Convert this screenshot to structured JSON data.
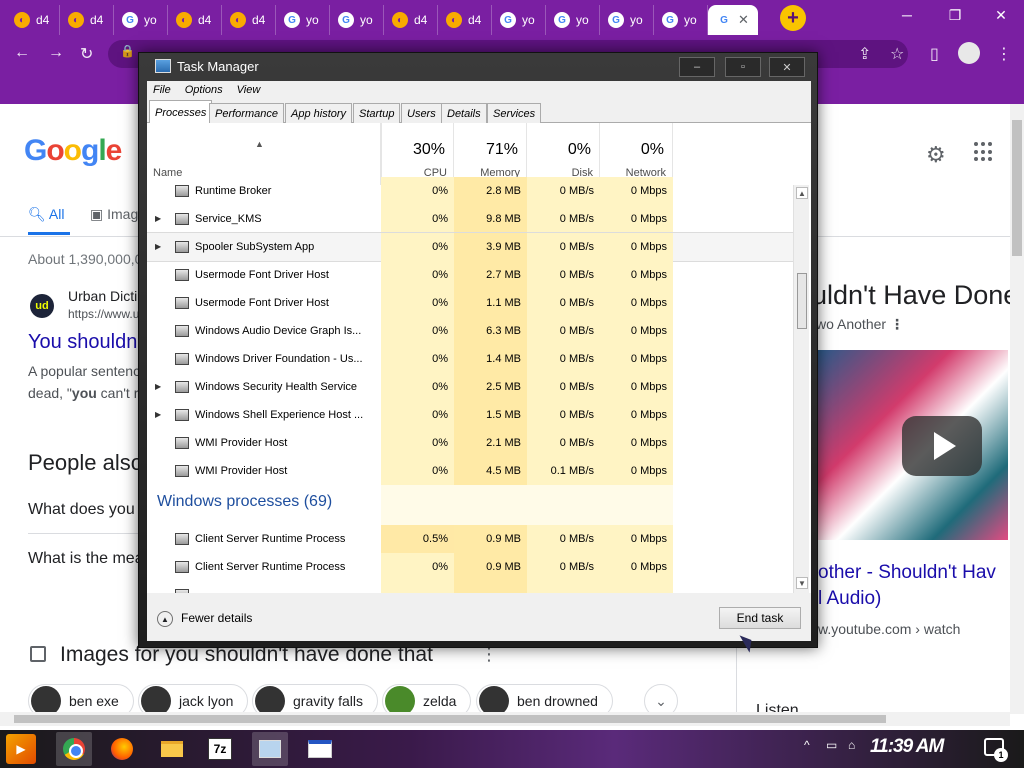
{
  "browser": {
    "tabs": [
      {
        "favicon": "d4-favicon",
        "label": "d4"
      },
      {
        "favicon": "d4-favicon",
        "label": "d4"
      },
      {
        "favicon": "google-favicon",
        "label": "yo"
      },
      {
        "favicon": "d4-favicon",
        "label": "d4"
      },
      {
        "favicon": "d4-favicon",
        "label": "d4"
      },
      {
        "favicon": "google-favicon",
        "label": "yo"
      },
      {
        "favicon": "google-favicon",
        "label": "yo"
      },
      {
        "favicon": "d4-favicon",
        "label": "d4"
      },
      {
        "favicon": "d4-favicon",
        "label": "d4"
      },
      {
        "favicon": "google-favicon",
        "label": "yo"
      },
      {
        "favicon": "google-favicon",
        "label": "yo"
      },
      {
        "favicon": "google-favicon",
        "label": "yo"
      },
      {
        "favicon": "google-favicon",
        "label": "yo"
      }
    ],
    "active_tab_close": "✕",
    "new_tab": "+",
    "theme_color": "#7a1fa2"
  },
  "google": {
    "logo": [
      "G",
      "o",
      "o",
      "g",
      "l",
      "e"
    ],
    "tab_all": "All",
    "tab_images": "Imag",
    "about": "About 1,390,000,0",
    "result": {
      "site_name": "Urban Dicti",
      "site_url": "https://www.u",
      "site_logo": "ud",
      "title": "You shouldn",
      "snippet1": "A popular sentenc",
      "snippet2_pre": "dead, \"",
      "snippet2_bold": "you",
      "snippet2_post": " can't r"
    },
    "people_also_ask": "People also",
    "paa_q1": "What does you",
    "paa_q2": "What is the mea",
    "images_title": "Images for you shouldn't have done that",
    "images_more": "⋮",
    "chips": [
      "ben exe",
      "jack lyon",
      "gravity falls",
      "zelda",
      "ben drowned"
    ],
    "chip_next": "⌄",
    "right_panel": {
      "title": "uldn't Have Done",
      "subtitle": "wo Another",
      "subtitle_menu": "⋮",
      "video_title1": "other - Shouldn't Hav",
      "video_title2": "l Audio)",
      "video_source": "w.youtube.com › watch",
      "listen": "Listen"
    }
  },
  "task_manager": {
    "title": "Task Manager",
    "controls": {
      "minimize": "–",
      "maximize": "▫",
      "close": "✕"
    },
    "menu": [
      "File",
      "Options",
      "View"
    ],
    "tabs": [
      "Processes",
      "Performance",
      "App history",
      "Startup",
      "Users",
      "Details",
      "Services"
    ],
    "active_tab": "Processes",
    "sort_indicator": "▲",
    "columns": {
      "name": "Name",
      "cpu": {
        "pct": "30%",
        "label": "CPU"
      },
      "memory": {
        "pct": "71%",
        "label": "Memory"
      },
      "disk": {
        "pct": "0%",
        "label": "Disk"
      },
      "network": {
        "pct": "0%",
        "label": "Network"
      }
    },
    "rows": [
      {
        "name": "Runtime Broker",
        "expand": "",
        "cpu": "0%",
        "mem": "2.8 MB",
        "disk": "0 MB/s",
        "net": "0 Mbps"
      },
      {
        "name": "Service_KMS",
        "expand": "▶",
        "cpu": "0%",
        "mem": "9.8 MB",
        "disk": "0 MB/s",
        "net": "0 Mbps"
      },
      {
        "name": "Spooler SubSystem App",
        "expand": "▶",
        "cpu": "0%",
        "mem": "3.9 MB",
        "disk": "0 MB/s",
        "net": "0 Mbps"
      },
      {
        "name": "Usermode Font Driver Host",
        "expand": "",
        "cpu": "0%",
        "mem": "2.7 MB",
        "disk": "0 MB/s",
        "net": "0 Mbps"
      },
      {
        "name": "Usermode Font Driver Host",
        "expand": "",
        "cpu": "0%",
        "mem": "1.1 MB",
        "disk": "0 MB/s",
        "net": "0 Mbps"
      },
      {
        "name": "Windows Audio Device Graph Is...",
        "expand": "",
        "cpu": "0%",
        "mem": "6.3 MB",
        "disk": "0 MB/s",
        "net": "0 Mbps"
      },
      {
        "name": "Windows Driver Foundation - Us...",
        "expand": "",
        "cpu": "0%",
        "mem": "1.4 MB",
        "disk": "0 MB/s",
        "net": "0 Mbps"
      },
      {
        "name": "Windows Security Health Service",
        "expand": "▶",
        "cpu": "0%",
        "mem": "2.5 MB",
        "disk": "0 MB/s",
        "net": "0 Mbps"
      },
      {
        "name": "Windows Shell Experience Host ...",
        "expand": "▶",
        "cpu": "0%",
        "mem": "1.5 MB",
        "disk": "0 MB/s",
        "net": "0 Mbps"
      },
      {
        "name": "WMI Provider Host",
        "expand": "",
        "cpu": "0%",
        "mem": "2.1 MB",
        "disk": "0 MB/s",
        "net": "0 Mbps"
      },
      {
        "name": "WMI Provider Host",
        "expand": "",
        "cpu": "0%",
        "mem": "4.5 MB",
        "disk": "0.1 MB/s",
        "net": "0 Mbps"
      }
    ],
    "group_header": "Windows processes (69)",
    "rows2": [
      {
        "name": "Client Server Runtime Process",
        "cpu": "0.5%",
        "mem": "0.9 MB",
        "disk": "0 MB/s",
        "net": "0 Mbps"
      },
      {
        "name": "Client Server Runtime Process",
        "cpu": "0%",
        "mem": "0.9 MB",
        "disk": "0 MB/s",
        "net": "0 Mbps"
      }
    ],
    "fewer_details": "Fewer details",
    "fewer_icon": "▲",
    "end_task": "End task"
  },
  "taskbar": {
    "start_label": "▶",
    "clock": "11:39 AM",
    "tray_icons": [
      "display-icon",
      "network-icon",
      "volume-icon"
    ],
    "tray_expand": "^",
    "notification_count": "1",
    "seven_zip": "7z"
  }
}
